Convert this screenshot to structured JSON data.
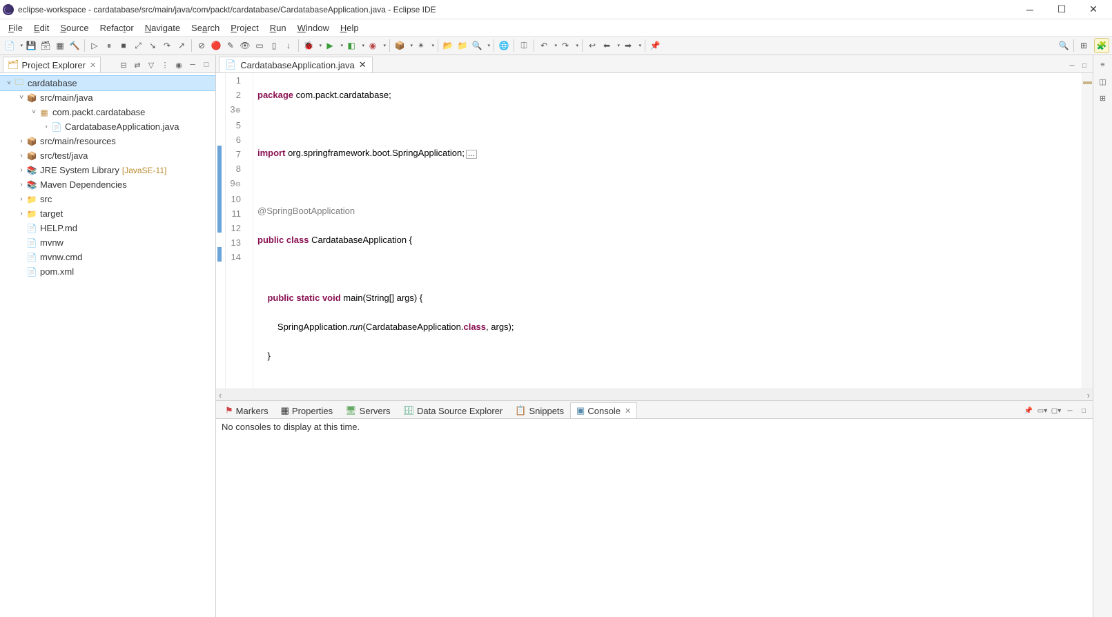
{
  "window": {
    "title": "eclipse-workspace - cardatabase/src/main/java/com/packt/cardatabase/CardatabaseApplication.java - Eclipse IDE"
  },
  "menu": [
    "File",
    "Edit",
    "Source",
    "Refactor",
    "Navigate",
    "Search",
    "Project",
    "Run",
    "Window",
    "Help"
  ],
  "explorer": {
    "title": "Project Explorer",
    "tree": {
      "project": "cardatabase",
      "srcMainJava": "src/main/java",
      "pkg": "com.packt.cardatabase",
      "appJava": "CardatabaseApplication.java",
      "srcMainRes": "src/main/resources",
      "srcTestJava": "src/test/java",
      "jre": "JRE System Library",
      "jreDec": "[JavaSE-11]",
      "maven": "Maven Dependencies",
      "srcFolder": "src",
      "target": "target",
      "help": "HELP.md",
      "mvnw": "mvnw",
      "mvnwcmd": "mvnw.cmd",
      "pom": "pom.xml"
    }
  },
  "editor": {
    "tab": "CardatabaseApplication.java",
    "lines": {
      "l1": {
        "kw1": "package",
        "rest": " com.packt.cardatabase;"
      },
      "l3": {
        "kw1": "import",
        "rest": " org.springframework.boot.SpringApplication;",
        "fold": "⊞"
      },
      "l6": {
        "ann": "@SpringBootApplication"
      },
      "l7": {
        "kw1": "public",
        "kw2": "class",
        "name": " CardatabaseApplication {"
      },
      "l9": {
        "indent": "    ",
        "kw1": "public",
        "kw2": "static",
        "kw3": "void",
        "sig": " main(String[] args) {"
      },
      "l10": {
        "indent": "        ",
        "pre": "SpringApplication.",
        "run": "run",
        "mid": "(CardatabaseApplication.",
        "cls": "class",
        "post": ", args);"
      },
      "l11": {
        "text": "    }"
      },
      "l13": {
        "text": "}"
      }
    },
    "lineNumbers": [
      "1",
      "2",
      "3",
      "5",
      "6",
      "7",
      "8",
      "9",
      "10",
      "11",
      "12",
      "13",
      "14"
    ]
  },
  "bottom": {
    "tabs": [
      "Markers",
      "Properties",
      "Servers",
      "Data Source Explorer",
      "Snippets",
      "Console"
    ],
    "activeIdx": 5,
    "consoleMsg": "No consoles to display at this time."
  }
}
